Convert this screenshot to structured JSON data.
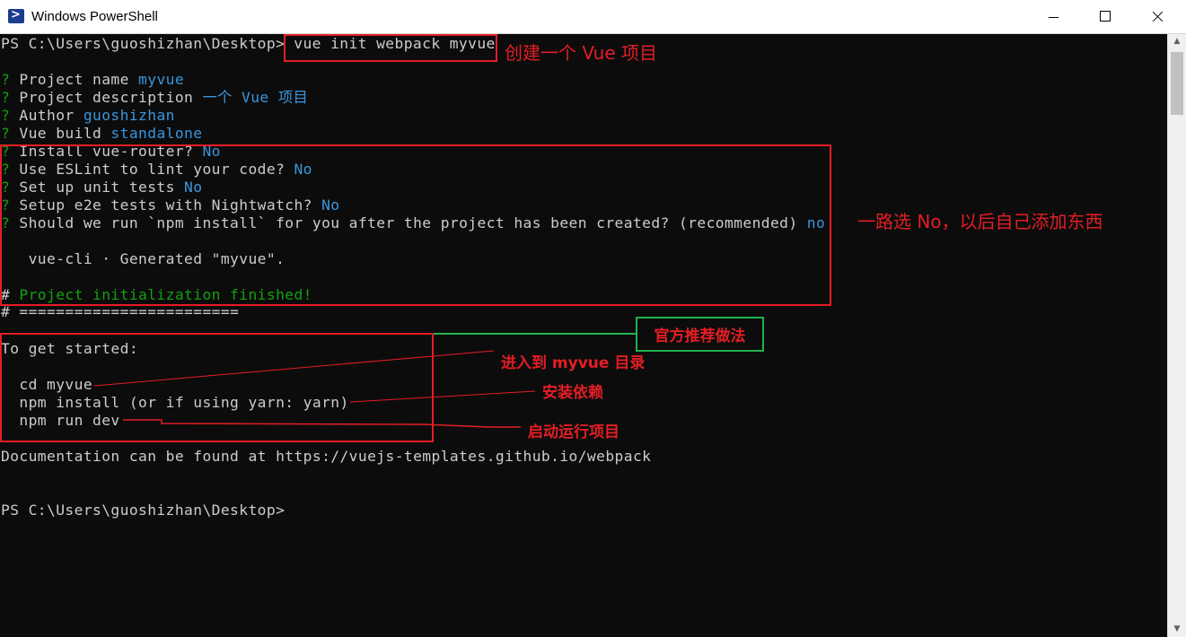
{
  "window": {
    "title": "Windows PowerShell",
    "icon": "powershell-icon",
    "controls": {
      "minimize": "minimize-icon",
      "maximize": "maximize-icon",
      "close": "close-icon"
    }
  },
  "terminal": {
    "prompt_path": "PS C:\\Users\\guoshizhan\\Desktop>",
    "command": "vue init webpack myvue",
    "lines": [
      {
        "q": "?",
        "label": " Project name ",
        "value": "myvue"
      },
      {
        "q": "?",
        "label": " Project description ",
        "value": "一个 Vue 项目"
      },
      {
        "q": "?",
        "label": " Author ",
        "value": "guoshizhan"
      },
      {
        "q": "?",
        "label": " Vue build ",
        "value": "standalone"
      },
      {
        "q": "?",
        "label": " Install vue-router? ",
        "value": "No"
      },
      {
        "q": "?",
        "label": " Use ESLint to lint your code? ",
        "value": "No"
      },
      {
        "q": "?",
        "label": " Set up unit tests ",
        "value": "No"
      },
      {
        "q": "?",
        "label": " Setup e2e tests with Nightwatch? ",
        "value": "No"
      },
      {
        "q": "?",
        "label": " Should we run `npm install` for you after the project has been created? (recommended) ",
        "value": "no"
      }
    ],
    "generated": "   vue-cli · Generated \"myvue\".",
    "init_hash": "#",
    "init_finished": " Project initialization finished!",
    "separator": "# ========================",
    "to_get_started": "To get started:",
    "cmd_cd": "  cd myvue",
    "cmd_install": "  npm install (or if using yarn: yarn)",
    "cmd_dev": "  npm run dev",
    "documentation": "Documentation can be found at https://vuejs-templates.github.io/webpack",
    "final_prompt": "PS C:\\Users\\guoshizhan\\Desktop>"
  },
  "annotations": {
    "create_project": "创建一个 Vue 项目",
    "select_no": "一路选 No，以后自己添加东西",
    "official_way": "官方推荐做法",
    "enter_dir": "进入到 myvue 目录",
    "install_deps": "安装依赖",
    "run_project": "启动运行项目"
  },
  "colors": {
    "background": "#0c0c0c",
    "text": "#cccccc",
    "question": "#13a10e",
    "answer": "#3a96dd",
    "annotation_red": "#e41e24",
    "annotation_green": "#22b14c"
  }
}
